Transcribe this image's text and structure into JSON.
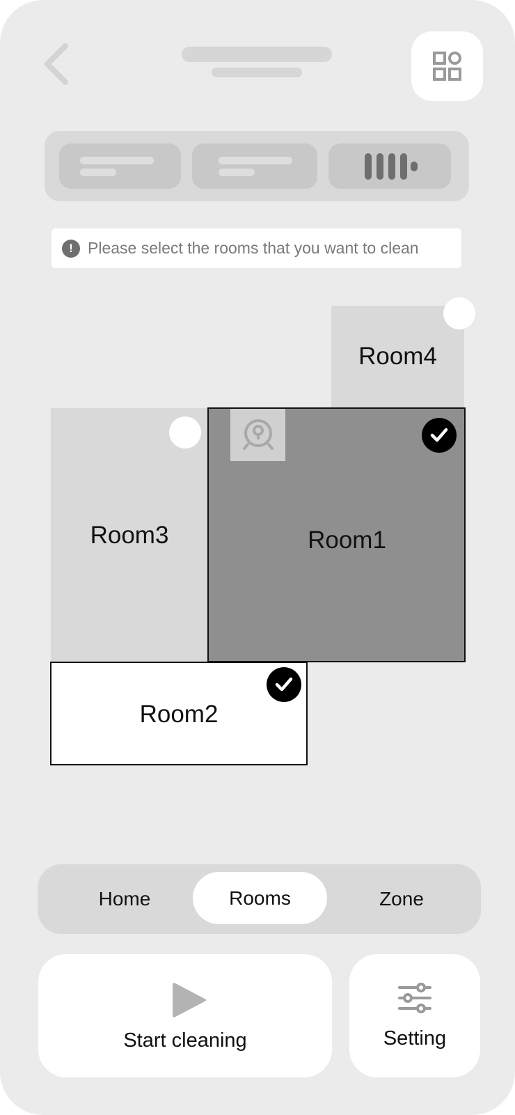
{
  "hint": {
    "icon": "exclamation-icon",
    "icon_glyph": "!",
    "text": "Please select the rooms that you want to clean"
  },
  "map": {
    "rooms": [
      {
        "id": "room4",
        "label": "Room4",
        "selected": false
      },
      {
        "id": "room3",
        "label": "Room3",
        "selected": false
      },
      {
        "id": "room1",
        "label": "Room1",
        "selected": true,
        "has_robot": true
      },
      {
        "id": "room2",
        "label": "Room2",
        "selected": true
      }
    ]
  },
  "tabs": {
    "items": [
      {
        "label": "Home",
        "active": false
      },
      {
        "label": "Rooms",
        "active": true
      },
      {
        "label": "Zone",
        "active": false
      }
    ]
  },
  "actions": {
    "start_label": "Start cleaning",
    "setting_label": "Setting"
  },
  "icons": {
    "back": "chevron-left-icon",
    "grid": "grid-icon",
    "robot": "robot-vacuum-icon",
    "play": "play-icon",
    "settings": "sliders-icon",
    "check": "check-icon"
  },
  "colors": {
    "background": "#ebebeb",
    "selected_room": "#8f8f8f",
    "unselected_room": "#d9d9d9",
    "accent": "#000000"
  }
}
